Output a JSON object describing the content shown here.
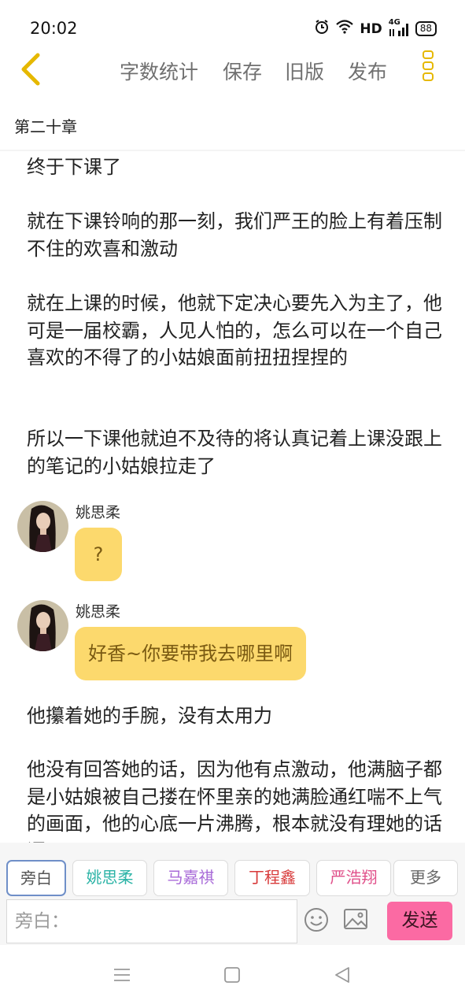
{
  "status_bar": {
    "time": "20:02",
    "network": "HD",
    "signal_label": "4G",
    "battery": "88"
  },
  "toolbar": {
    "word_count": "字数统计",
    "save": "保存",
    "old_version": "旧版",
    "publish": "发布"
  },
  "chapter_title": "第二十章",
  "content": {
    "paragraphs": [
      "终于下课了",
      "就在下课铃响的那一刻，我们严王的脸上有着压制不住的欢喜和激动",
      "就在上课的时候，他就下定决心要先入为主了，他可是一届校霸，人见人怕的，怎么可以在一个自己喜欢的不得了的小姑娘面前扭扭捏捏的",
      "所以一下课他就迫不及待的将认真记着上课没跟上的笔记的小姑娘拉走了",
      "他攥着她的手腕，没有太用力",
      "他没有回答她的话，因为他有点激动，他满脑子都是小姑娘被自己搂在怀里亲的她满脸通红喘不上气的画面，他的心底一片沸腾，根本就没有理她的话语"
    ],
    "messages": [
      {
        "name": "姚思柔",
        "text": "?"
      },
      {
        "name": "姚思柔",
        "text": "好香~你要带我去哪里啊"
      }
    ]
  },
  "roles": [
    {
      "label": "旁白",
      "color": "#555555"
    },
    {
      "label": "姚思柔",
      "color": "#2bb3a6"
    },
    {
      "label": "马嘉祺",
      "color": "#a86ad8"
    },
    {
      "label": "丁程鑫",
      "color": "#d83a3a"
    },
    {
      "label": "严浩翔",
      "color": "#e0508a"
    },
    {
      "label": "更多",
      "color": "#666666"
    }
  ],
  "input": {
    "placeholder": "旁白："
  },
  "send_label": "发送",
  "colors": {
    "accent_yellow": "#fcd96d",
    "send_pink": "#fb6aa3",
    "active_border": "#6f8fc8"
  }
}
